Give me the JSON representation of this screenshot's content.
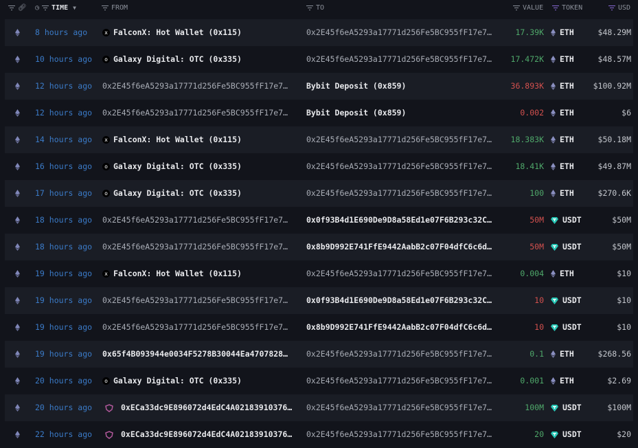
{
  "header": {
    "time": "TIME",
    "from": "FROM",
    "to": "TO",
    "value": "VALUE",
    "token": "TOKEN",
    "usd": "USD"
  },
  "colors": {
    "positive": "#4fa86a",
    "negative": "#d2504e",
    "time": "#3b7bc8",
    "accent": "#8a6ad6",
    "usdt": "#26c6b5"
  },
  "rows": [
    {
      "time": "8 hours ago",
      "from": "FalconX: Hot Wallet (0x115)",
      "from_type": "falconx",
      "to": "0x2E45f6eA5293a17771d256Fe5BC955fF17e7…",
      "to_type": "addr",
      "value": "17.39K",
      "dir": "pos",
      "token": "ETH",
      "usd": "$48.29M"
    },
    {
      "time": "10 hours ago",
      "from": "Galaxy Digital: OTC (0x335)",
      "from_type": "galaxy",
      "to": "0x2E45f6eA5293a17771d256Fe5BC955fF17e7…",
      "to_type": "addr",
      "value": "17.472K",
      "dir": "pos",
      "token": "ETH",
      "usd": "$48.57M"
    },
    {
      "time": "12 hours ago",
      "from": "0x2E45f6eA5293a17771d256Fe5BC955fF17e7…",
      "from_type": "addr",
      "to": "Bybit Deposit (0x859)",
      "to_type": "entity",
      "value": "36.893K",
      "dir": "neg",
      "token": "ETH",
      "usd": "$100.92M"
    },
    {
      "time": "12 hours ago",
      "from": "0x2E45f6eA5293a17771d256Fe5BC955fF17e7…",
      "from_type": "addr",
      "to": "Bybit Deposit (0x859)",
      "to_type": "entity",
      "value": "0.002",
      "dir": "neg",
      "token": "ETH",
      "usd": "$6"
    },
    {
      "time": "14 hours ago",
      "from": "FalconX: Hot Wallet (0x115)",
      "from_type": "falconx",
      "to": "0x2E45f6eA5293a17771d256Fe5BC955fF17e7…",
      "to_type": "addr",
      "value": "18.383K",
      "dir": "pos",
      "token": "ETH",
      "usd": "$50.18M"
    },
    {
      "time": "16 hours ago",
      "from": "Galaxy Digital: OTC (0x335)",
      "from_type": "galaxy",
      "to": "0x2E45f6eA5293a17771d256Fe5BC955fF17e7…",
      "to_type": "addr",
      "value": "18.41K",
      "dir": "pos",
      "token": "ETH",
      "usd": "$49.87M"
    },
    {
      "time": "17 hours ago",
      "from": "Galaxy Digital: OTC (0x335)",
      "from_type": "galaxy",
      "to": "0x2E45f6eA5293a17771d256Fe5BC955fF17e7…",
      "to_type": "addr",
      "value": "100",
      "dir": "pos",
      "token": "ETH",
      "usd": "$270.6K"
    },
    {
      "time": "18 hours ago",
      "from": "0x2E45f6eA5293a17771d256Fe5BC955fF17e7…",
      "from_type": "addr",
      "to": "0x0f93B4d1E690De9D8a58Ed1e07F6B293c32C…",
      "to_type": "strong",
      "value": "50M",
      "dir": "neg",
      "token": "USDT",
      "usd": "$50M"
    },
    {
      "time": "18 hours ago",
      "from": "0x2E45f6eA5293a17771d256Fe5BC955fF17e7…",
      "from_type": "addr",
      "to": "0x8b9D992E741FfE9442AabB2c07F04dfC6c6d…",
      "to_type": "strong",
      "value": "50M",
      "dir": "neg",
      "token": "USDT",
      "usd": "$50M"
    },
    {
      "time": "19 hours ago",
      "from": "FalconX: Hot Wallet (0x115)",
      "from_type": "falconx",
      "to": "0x2E45f6eA5293a17771d256Fe5BC955fF17e7…",
      "to_type": "addr",
      "value": "0.004",
      "dir": "pos",
      "token": "ETH",
      "usd": "$10"
    },
    {
      "time": "19 hours ago",
      "from": "0x2E45f6eA5293a17771d256Fe5BC955fF17e7…",
      "from_type": "addr",
      "to": "0x0f93B4d1E690De9D8a58Ed1e07F6B293c32C…",
      "to_type": "strong",
      "value": "10",
      "dir": "neg",
      "token": "USDT",
      "usd": "$10"
    },
    {
      "time": "19 hours ago",
      "from": "0x2E45f6eA5293a17771d256Fe5BC955fF17e7…",
      "from_type": "addr",
      "to": "0x8b9D992E741FfE9442AabB2c07F04dfC6c6d…",
      "to_type": "strong",
      "value": "10",
      "dir": "neg",
      "token": "USDT",
      "usd": "$10"
    },
    {
      "time": "19 hours ago",
      "from": "0x65f4B093944e0034F5278B30044Ea4707828…",
      "from_type": "strong",
      "to": "0x2E45f6eA5293a17771d256Fe5BC955fF17e7…",
      "to_type": "addr",
      "value": "0.1",
      "dir": "pos",
      "token": "ETH",
      "usd": "$268.56"
    },
    {
      "time": "20 hours ago",
      "from": "Galaxy Digital: OTC (0x335)",
      "from_type": "galaxy",
      "to": "0x2E45f6eA5293a17771d256Fe5BC955fF17e7…",
      "to_type": "addr",
      "value": "0.001",
      "dir": "pos",
      "token": "ETH",
      "usd": "$2.69"
    },
    {
      "time": "20 hours ago",
      "from": "0xECa33dc9E896072d4EdC4A02183910376…",
      "from_type": "shield",
      "to": "0x2E45f6eA5293a17771d256Fe5BC955fF17e7…",
      "to_type": "addr",
      "value": "100M",
      "dir": "pos",
      "token": "USDT",
      "usd": "$100M"
    },
    {
      "time": "22 hours ago",
      "from": "0xECa33dc9E896072d4EdC4A02183910376…",
      "from_type": "shield",
      "to": "0x2E45f6eA5293a17771d256Fe5BC955fF17e7…",
      "to_type": "addr",
      "value": "20",
      "dir": "pos",
      "token": "USDT",
      "usd": "$20"
    }
  ]
}
